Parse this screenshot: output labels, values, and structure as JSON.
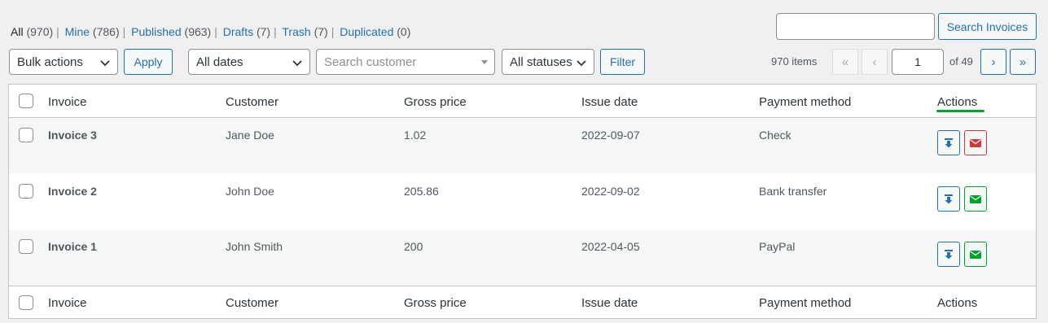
{
  "views": [
    {
      "label": "All",
      "count": "(970)",
      "current": true
    },
    {
      "label": "Mine",
      "count": "(786)"
    },
    {
      "label": "Published",
      "count": "(963)"
    },
    {
      "label": "Drafts",
      "count": "(7)"
    },
    {
      "label": "Trash",
      "count": "(7)"
    },
    {
      "label": "Duplicated",
      "count": "(0)"
    }
  ],
  "search": {
    "button_label": "Search Invoices",
    "value": ""
  },
  "controls": {
    "bulk_actions": "Bulk actions",
    "apply_label": "Apply",
    "dates": "All dates",
    "customer_placeholder": "Search customer",
    "statuses": "All statuses",
    "filter_label": "Filter"
  },
  "pagination": {
    "items_count": "970 items",
    "first": "«",
    "prev": "‹",
    "current_page": "1",
    "of_pages": "of 49",
    "next": "›",
    "last": "»"
  },
  "table": {
    "columns": [
      "Invoice",
      "Customer",
      "Gross price",
      "Issue date",
      "Payment method",
      "Actions"
    ],
    "rows": [
      {
        "invoice": "Invoice 3",
        "customer": "Jane Doe",
        "gross": "1.02",
        "date": "2022-09-07",
        "payment": "Check",
        "mail_status": "red"
      },
      {
        "invoice": "Invoice 2",
        "customer": "John Doe",
        "gross": "205.86",
        "date": "2022-09-02",
        "payment": "Bank transfer",
        "mail_status": "green"
      },
      {
        "invoice": "Invoice 1",
        "customer": "John Smith",
        "gross": "200",
        "date": "2022-04-05",
        "payment": "PayPal",
        "mail_status": "green"
      }
    ]
  },
  "colors": {
    "accent": "#2271b1",
    "mail_red": "#d63638",
    "mail_green": "#00a32a",
    "actions_underline": "#00a32a"
  },
  "icons": {
    "download": "download-icon",
    "mail": "envelope-icon",
    "chevron": "chevron-down-icon"
  }
}
